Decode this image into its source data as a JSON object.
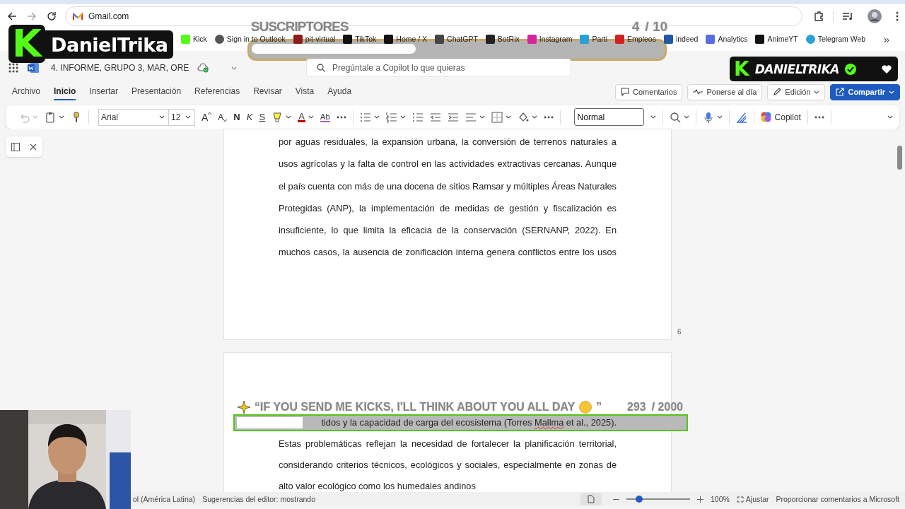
{
  "browser": {
    "address": "Gmail.com",
    "bookmarks": [
      {
        "label": "Kick"
      },
      {
        "label": "Sign in to Outlook"
      },
      {
        "label": "pit-virtual"
      },
      {
        "label": "TikTok"
      },
      {
        "label": "Home / X"
      },
      {
        "label": "ChatGPT"
      },
      {
        "label": "BotRix"
      },
      {
        "label": "Instagram"
      },
      {
        "label": "Parti"
      },
      {
        "label": "Empleos"
      },
      {
        "label": "indeed"
      },
      {
        "label": "Analytics"
      },
      {
        "label": "AnimeYT"
      },
      {
        "label": "Telegram Web"
      }
    ],
    "more": "»"
  },
  "word": {
    "doc_title": "4. INFORME, GRUPO 3, MAR, ORE",
    "search_placeholder": "Pregúntale a Copilot lo que quieras",
    "tabs": [
      {
        "label": "Archivo",
        "selected": false
      },
      {
        "label": "Inicio",
        "selected": true
      },
      {
        "label": "Insertar",
        "selected": false
      },
      {
        "label": "Presentación",
        "selected": false
      },
      {
        "label": "Referencias",
        "selected": false
      },
      {
        "label": "Revisar",
        "selected": false
      },
      {
        "label": "Vista",
        "selected": false
      },
      {
        "label": "Ayuda",
        "selected": false
      }
    ],
    "actions": [
      {
        "label": "Comentarios",
        "kind": "comment"
      },
      {
        "label": "Ponerse al día",
        "kind": "catchup"
      },
      {
        "label": "Edición",
        "kind": "edit"
      },
      {
        "label": "Compartir",
        "kind": "share"
      }
    ],
    "toolbar": {
      "font": "Arial",
      "size": "12",
      "grow": "A",
      "shrink": "A",
      "bold": "N",
      "italic": "K",
      "strike": "S",
      "font_color": "A",
      "clear": "Ab",
      "style": "Normal",
      "copilot": "Copilot"
    }
  },
  "document": {
    "page_number": "6",
    "pages": [
      {
        "lines": [
          {
            "kind": "full",
            "parts": [
              {
                "text": "por aguas residuales, la expansión urbana, la conversión de terrenos naturales a"
              }
            ]
          },
          {
            "kind": "full",
            "parts": [
              {
                "text": "usos agrícolas y la falta de control en las actividades extractivas cercanas. Aunque"
              }
            ]
          },
          {
            "kind": "full",
            "parts": [
              {
                "text": "el país cuenta con más de una docena de sitios Ramsar y múltiples Áreas Naturales"
              }
            ]
          },
          {
            "kind": "full",
            "parts": [
              {
                "text": "Protegidas (ANP), la implementación de medidas de gestión y fiscalización es"
              }
            ]
          },
          {
            "kind": "full",
            "parts": [
              {
                "text": "insuficiente, lo que limita la eficacia de la conservación (SERNANP, 2022). En"
              }
            ]
          },
          {
            "kind": "full",
            "parts": [
              {
                "text": "muchos casos, la ausencia de zonificación interna genera conflictos entre los usos"
              }
            ]
          }
        ]
      },
      {
        "lines": [
          {
            "kind": "tail",
            "parts": [
              {
                "text": "tidos y la capacidad de carga del ecosistema (Torres ",
                "misspelled": false
              },
              {
                "text": "Mallma",
                "misspelled": true
              },
              {
                "text": " et al., 2025).",
                "misspelled": false
              }
            ]
          },
          {
            "kind": "full",
            "parts": [
              {
                "text": "Estas problemáticas reflejan la necesidad de fortalecer la planificación territorial,"
              }
            ]
          },
          {
            "kind": "full",
            "parts": [
              {
                "text": "considerando criterios técnicos, ecológicos y sociales, especialmente en zonas de"
              }
            ]
          },
          {
            "kind": "last",
            "parts": [
              {
                "text": "alto valor ecológico como los humedales andinos"
              }
            ]
          }
        ]
      }
    ]
  },
  "status": {
    "language": "ol (América Latina)",
    "editor": "Sugerencias del editor: mostrando",
    "zoom_slider": {
      "level": 0.2
    },
    "zoom": "100%",
    "fit": "Ajustar",
    "feedback": "Proporcionar comentarios a Microsoft"
  },
  "stream": {
    "logo_letter": "K",
    "logo_name": "DanielTrika",
    "subs_goal": {
      "title": "SUSCRIPTORES",
      "count": "4",
      "total": "/ 10",
      "level": 0.4
    },
    "badge": {
      "letter": "K",
      "name": "DANIELTRIKA",
      "verified": true
    },
    "kicks_goal": {
      "message": "“IF YOU SEND ME KICKS, I'LL THINK ABOUT YOU ALL DAY",
      "close": "”",
      "count": "293",
      "total": "/ 2000",
      "level": 0.1465
    }
  }
}
